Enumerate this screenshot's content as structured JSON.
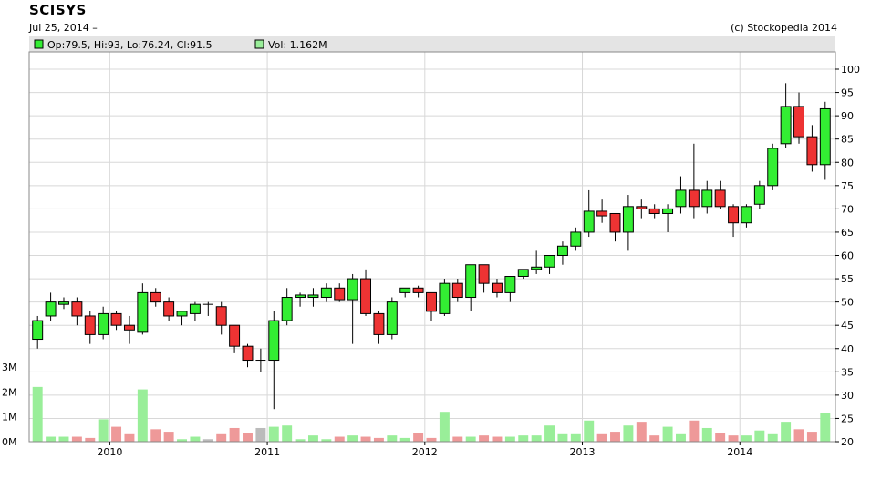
{
  "header": {
    "title": "SCISYS",
    "date": "Jul 25, 2014 –",
    "copyright": "(c) Stockopedia 2014"
  },
  "legend": {
    "ohlc": "Op:79.5, Hi:93, Lo:76.24, Cl:91.5",
    "volume": "Vol: 1.162M"
  },
  "colors": {
    "up": "#33ee33",
    "down": "#ee3333",
    "vol_up": "#99ee99",
    "vol_down": "#ee9999",
    "vol_flat": "#bbbbbb",
    "grid": "#d8d8d8",
    "legend_bg": "#e4e4e4"
  },
  "chart_data": {
    "type": "candlestick",
    "interval": "monthly",
    "price_axis": {
      "min": 20,
      "max": 100,
      "ticks": [
        20,
        25,
        30,
        35,
        40,
        45,
        50,
        55,
        60,
        65,
        70,
        75,
        80,
        85,
        90,
        95,
        100
      ],
      "position": "right"
    },
    "volume_axis": {
      "min": 0,
      "max": 3,
      "unit": "M",
      "ticks": [
        "0M",
        "1M",
        "2M",
        "3M"
      ],
      "position": "left"
    },
    "x_ticks": [
      "2010",
      "2011",
      "2012",
      "2013",
      "2014"
    ],
    "grid": true,
    "candles": [
      {
        "o": 42,
        "h": 47,
        "l": 40,
        "c": 46,
        "v": 2.2
      },
      {
        "o": 47,
        "h": 52,
        "l": 46,
        "c": 50,
        "v": 0.2
      },
      {
        "o": 49.5,
        "h": 51,
        "l": 48.5,
        "c": 50,
        "v": 0.2
      },
      {
        "o": 50,
        "h": 51,
        "l": 45,
        "c": 47,
        "v": 0.2
      },
      {
        "o": 47,
        "h": 48,
        "l": 41,
        "c": 43,
        "v": 0.15
      },
      {
        "o": 43,
        "h": 49,
        "l": 42,
        "c": 47.5,
        "v": 0.9
      },
      {
        "o": 47.5,
        "h": 48,
        "l": 44,
        "c": 45,
        "v": 0.6
      },
      {
        "o": 45,
        "h": 47,
        "l": 41,
        "c": 44,
        "v": 0.3
      },
      {
        "o": 43.5,
        "h": 54,
        "l": 43,
        "c": 52,
        "v": 2.1
      },
      {
        "o": 52,
        "h": 53,
        "l": 49,
        "c": 50,
        "v": 0.5
      },
      {
        "o": 50,
        "h": 51,
        "l": 46,
        "c": 47,
        "v": 0.4
      },
      {
        "o": 47,
        "h": 48,
        "l": 45,
        "c": 48,
        "v": 0.1
      },
      {
        "o": 47.5,
        "h": 50,
        "l": 46,
        "c": 49.5,
        "v": 0.2
      },
      {
        "o": 49.5,
        "h": 50,
        "l": 47,
        "c": 49.5,
        "v": 0.1
      },
      {
        "o": 49,
        "h": 50,
        "l": 43,
        "c": 45,
        "v": 0.3
      },
      {
        "o": 45,
        "h": 45,
        "l": 39,
        "c": 40.5,
        "v": 0.55
      },
      {
        "o": 40.5,
        "h": 41,
        "l": 36,
        "c": 37.5,
        "v": 0.35
      },
      {
        "o": 37.5,
        "h": 40,
        "l": 35,
        "c": 37.5,
        "v": 0.55
      },
      {
        "o": 37.5,
        "h": 48,
        "l": 27,
        "c": 46,
        "v": 0.6
      },
      {
        "o": 46,
        "h": 53,
        "l": 45,
        "c": 51,
        "v": 0.65
      },
      {
        "o": 51,
        "h": 52,
        "l": 49,
        "c": 51.5,
        "v": 0.1
      },
      {
        "o": 51,
        "h": 53,
        "l": 49,
        "c": 51.5,
        "v": 0.25
      },
      {
        "o": 51,
        "h": 54,
        "l": 50,
        "c": 53,
        "v": 0.1
      },
      {
        "o": 53,
        "h": 54,
        "l": 50,
        "c": 50.5,
        "v": 0.2
      },
      {
        "o": 50.5,
        "h": 56,
        "l": 41,
        "c": 55,
        "v": 0.25
      },
      {
        "o": 55,
        "h": 57,
        "l": 47,
        "c": 47.5,
        "v": 0.2
      },
      {
        "o": 47.5,
        "h": 48,
        "l": 41,
        "c": 43,
        "v": 0.15
      },
      {
        "o": 43,
        "h": 51,
        "l": 42,
        "c": 50,
        "v": 0.25
      },
      {
        "o": 52,
        "h": 53,
        "l": 51,
        "c": 53,
        "v": 0.15
      },
      {
        "o": 53,
        "h": 53.5,
        "l": 51,
        "c": 52,
        "v": 0.35
      },
      {
        "o": 52,
        "h": 52,
        "l": 46,
        "c": 48,
        "v": 0.15
      },
      {
        "o": 47.5,
        "h": 55,
        "l": 47,
        "c": 54,
        "v": 1.2
      },
      {
        "o": 54,
        "h": 55,
        "l": 50,
        "c": 51,
        "v": 0.2
      },
      {
        "o": 51,
        "h": 58,
        "l": 48,
        "c": 58,
        "v": 0.2
      },
      {
        "o": 58,
        "h": 58,
        "l": 52,
        "c": 54,
        "v": 0.25
      },
      {
        "o": 54,
        "h": 55,
        "l": 51,
        "c": 52,
        "v": 0.2
      },
      {
        "o": 52,
        "h": 55,
        "l": 50,
        "c": 55.5,
        "v": 0.2
      },
      {
        "o": 55.5,
        "h": 57,
        "l": 55,
        "c": 57,
        "v": 0.25
      },
      {
        "o": 57,
        "h": 61,
        "l": 56,
        "c": 57.5,
        "v": 0.25
      },
      {
        "o": 57.5,
        "h": 60,
        "l": 56,
        "c": 60,
        "v": 0.65
      },
      {
        "o": 60,
        "h": 63,
        "l": 58,
        "c": 62,
        "v": 0.3
      },
      {
        "o": 62,
        "h": 66,
        "l": 61,
        "c": 65,
        "v": 0.3
      },
      {
        "o": 65,
        "h": 74,
        "l": 64,
        "c": 69.5,
        "v": 0.85
      },
      {
        "o": 69.5,
        "h": 72,
        "l": 67,
        "c": 68.5,
        "v": 0.3
      },
      {
        "o": 69,
        "h": 69,
        "l": 63,
        "c": 65,
        "v": 0.4
      },
      {
        "o": 65,
        "h": 73,
        "l": 61,
        "c": 70.5,
        "v": 0.65
      },
      {
        "o": 70.5,
        "h": 72,
        "l": 68,
        "c": 70,
        "v": 0.8
      },
      {
        "o": 70,
        "h": 71,
        "l": 68,
        "c": 69,
        "v": 0.25
      },
      {
        "o": 69,
        "h": 71,
        "l": 65,
        "c": 70,
        "v": 0.6
      },
      {
        "o": 70.5,
        "h": 77,
        "l": 69,
        "c": 74,
        "v": 0.3
      },
      {
        "o": 74,
        "h": 84,
        "l": 68,
        "c": 70.5,
        "v": 0.85
      },
      {
        "o": 70.5,
        "h": 76,
        "l": 69,
        "c": 74,
        "v": 0.55
      },
      {
        "o": 74,
        "h": 76,
        "l": 70,
        "c": 70.5,
        "v": 0.35
      },
      {
        "o": 70.5,
        "h": 71,
        "l": 64,
        "c": 67,
        "v": 0.25
      },
      {
        "o": 67,
        "h": 71,
        "l": 66,
        "c": 70.5,
        "v": 0.25
      },
      {
        "o": 71,
        "h": 76,
        "l": 70,
        "c": 75,
        "v": 0.45
      },
      {
        "o": 75,
        "h": 84,
        "l": 74,
        "c": 83,
        "v": 0.3
      },
      {
        "o": 84,
        "h": 97,
        "l": 83,
        "c": 92,
        "v": 0.8
      },
      {
        "o": 92,
        "h": 95,
        "l": 84,
        "c": 85.5,
        "v": 0.5
      },
      {
        "o": 85.5,
        "h": 88,
        "l": 78,
        "c": 79.5,
        "v": 0.4
      },
      {
        "o": 79.5,
        "h": 93,
        "l": 76.24,
        "c": 91.5,
        "v": 1.162
      }
    ]
  }
}
